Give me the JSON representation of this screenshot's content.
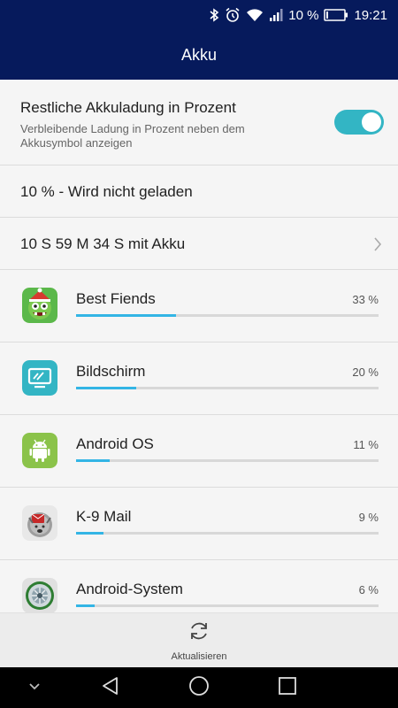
{
  "status_bar": {
    "battery_text": "10 %",
    "time": "19:21",
    "icons": [
      "bluetooth-icon",
      "alarm-icon",
      "wifi-icon",
      "signal-icon",
      "battery-icon"
    ],
    "battery_level": 0.1
  },
  "header": {
    "title": "Akku"
  },
  "percent_setting": {
    "title": "Restliche Akkuladung in Prozent",
    "description": "Verbleibende Ladung in Prozent neben dem Akkusymbol anzeigen",
    "enabled": true
  },
  "status": {
    "charge": "10 % - Wird nicht geladen",
    "runtime": "10 S 59 M 34 S mit Akku"
  },
  "apps": [
    {
      "name": "Best Fiends",
      "percent_label": "33 %",
      "percent": 33,
      "icon": "best-fiends-icon"
    },
    {
      "name": "Bildschirm",
      "percent_label": "20 %",
      "percent": 20,
      "icon": "screen-icon"
    },
    {
      "name": "Android OS",
      "percent_label": "11 %",
      "percent": 11,
      "icon": "android-icon"
    },
    {
      "name": "K-9 Mail",
      "percent_label": "9 %",
      "percent": 9,
      "icon": "k9-mail-icon"
    },
    {
      "name": "Android-System",
      "percent_label": "6 %",
      "percent": 6,
      "icon": "android-system-icon"
    }
  ],
  "bottom": {
    "refresh_label": "Aktualisieren"
  },
  "colors": {
    "primary": "#061a5c",
    "accent": "#33b5c4",
    "bar": "#33b5e5"
  }
}
